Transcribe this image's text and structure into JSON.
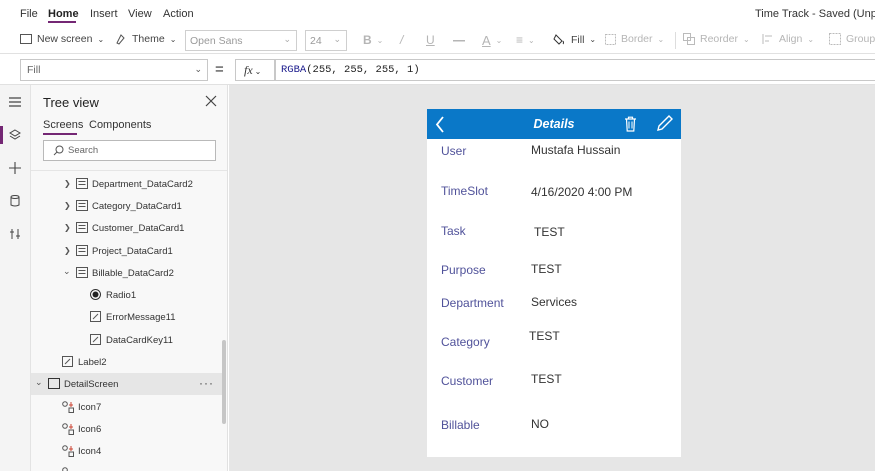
{
  "menubar": {
    "items": [
      "File",
      "Home",
      "Insert",
      "View",
      "Action"
    ],
    "active": "Home",
    "app_title": "Time Track - Saved (Unpubli"
  },
  "ribbon": {
    "new_screen": "New screen",
    "theme": "Theme",
    "font_family": "Open Sans",
    "font_size": "24",
    "fill": "Fill",
    "border": "Border",
    "reorder": "Reorder",
    "align": "Align",
    "group": "Group"
  },
  "formula": {
    "property": "Fill",
    "equals": "=",
    "fx": "fx",
    "function_name": "RGBA",
    "arguments": "(255, 255, 255, 1)"
  },
  "tree": {
    "title": "Tree view",
    "tabs": [
      "Screens",
      "Components"
    ],
    "search_placeholder": "Search",
    "nodes": [
      {
        "label": "Department_DataCard2",
        "icon": "datacard-icon",
        "chevron": "right"
      },
      {
        "label": "Category_DataCard1",
        "icon": "datacard-icon",
        "chevron": "right"
      },
      {
        "label": "Customer_DataCard1",
        "icon": "datacard-icon",
        "chevron": "right"
      },
      {
        "label": "Project_DataCard1",
        "icon": "datacard-icon",
        "chevron": "right"
      },
      {
        "label": "Billable_DataCard2",
        "icon": "datacard-icon",
        "chevron": "down"
      },
      {
        "label": "Radio1",
        "icon": "radio-icon"
      },
      {
        "label": "ErrorMessage11",
        "icon": "label-edit-icon"
      },
      {
        "label": "DataCardKey11",
        "icon": "label-edit-icon"
      },
      {
        "label": "Label2",
        "icon": "label-edit-icon"
      },
      {
        "label": "DetailScreen",
        "icon": "screen-icon",
        "chevron": "down",
        "selected": true
      },
      {
        "label": "Icon7",
        "icon": "shapes-icon"
      },
      {
        "label": "Icon6",
        "icon": "shapes-icon"
      },
      {
        "label": "Icon4",
        "icon": "shapes-icon"
      }
    ]
  },
  "app_screen": {
    "header_title": "Details",
    "header_color": "#0a78c8",
    "label_color": "#50529a",
    "fields": [
      {
        "label": "User",
        "value": "Mustafa Hussain"
      },
      {
        "label": "TimeSlot",
        "value": "4/16/2020 4:00 PM"
      },
      {
        "label": "Task",
        "value": "TEST"
      },
      {
        "label": "Purpose",
        "value": "TEST"
      },
      {
        "label": "Department",
        "value": "Services"
      },
      {
        "label": "Category",
        "value": "TEST"
      },
      {
        "label": "Customer",
        "value": "TEST"
      },
      {
        "label": "Billable",
        "value": "NO"
      }
    ]
  },
  "colors": {
    "accent": "#742774",
    "canvas_bg": "#e6e6e6"
  }
}
